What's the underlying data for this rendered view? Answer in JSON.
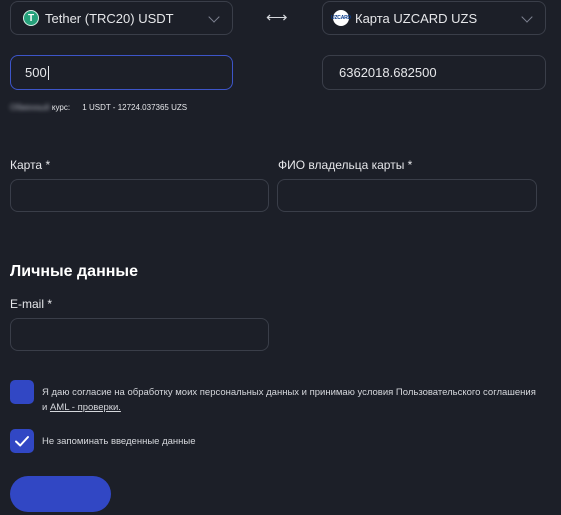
{
  "exchange": {
    "from_currency": "Tether (TRC20) USDT",
    "from_icon": "T",
    "swap_icon": "⟷",
    "to_currency": "Карта UZCARD UZS",
    "to_icon": "UZCARD",
    "amount_from": "500",
    "amount_to": "6362018.682500",
    "rate_prefix": "Обменный",
    "rate_label": "курс:",
    "rate_value": "1 USDT - 12724.037365 UZS"
  },
  "card_form": {
    "card_label": "Карта *",
    "holder_label": "ФИО владельца карты *"
  },
  "personal": {
    "heading": "Личные данные",
    "email_label": "E-mail *"
  },
  "consent": {
    "text": "Я даю согласие на обработку моих персональных данных и принимаю условия Пользовательского соглашения",
    "and": "и",
    "aml_link": "AML - проверки.",
    "remember_text": "Не запоминать введенные данные",
    "remember_checked": true
  },
  "colors": {
    "accent": "#3147c4",
    "background": "#1c1f28",
    "border": "#3a3e49"
  }
}
